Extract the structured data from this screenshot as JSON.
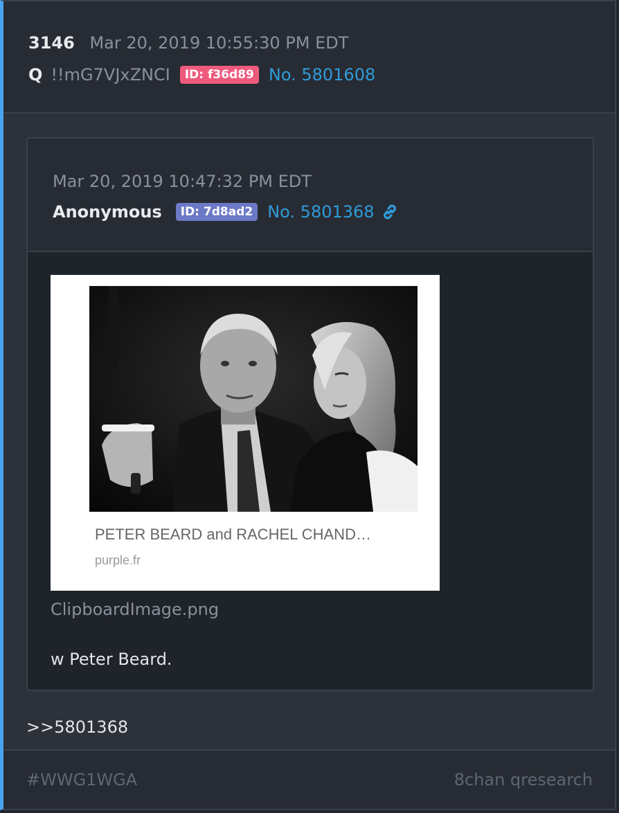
{
  "post": {
    "number": "3146",
    "timestamp": "Mar 20, 2019 10:55:30 PM EDT",
    "author": "Q",
    "tripcode": "!!mG7VJxZNCI",
    "id_badge": "ID: f36d89",
    "post_no": "No. 5801608"
  },
  "quoted": {
    "timestamp": "Mar 20, 2019 10:47:32 PM EDT",
    "author": "Anonymous",
    "id_badge": "ID: 7d8ad2",
    "post_no": "No. 5801368",
    "image": {
      "caption": "PETER BEARD and RACHEL CHAND…",
      "source": "purple.fr",
      "filename": "ClipboardImage.png"
    },
    "text": "w Peter Beard."
  },
  "reply_text": ">>5801368",
  "footer": {
    "tag": "#WWG1WGA",
    "board": "8chan qresearch"
  },
  "colors": {
    "accent": "#4aa3f0",
    "id_q": "#ee5a7c",
    "id_anon": "#6c79c6",
    "link": "#2f9bd8"
  },
  "icons": {
    "link": "link-icon"
  }
}
